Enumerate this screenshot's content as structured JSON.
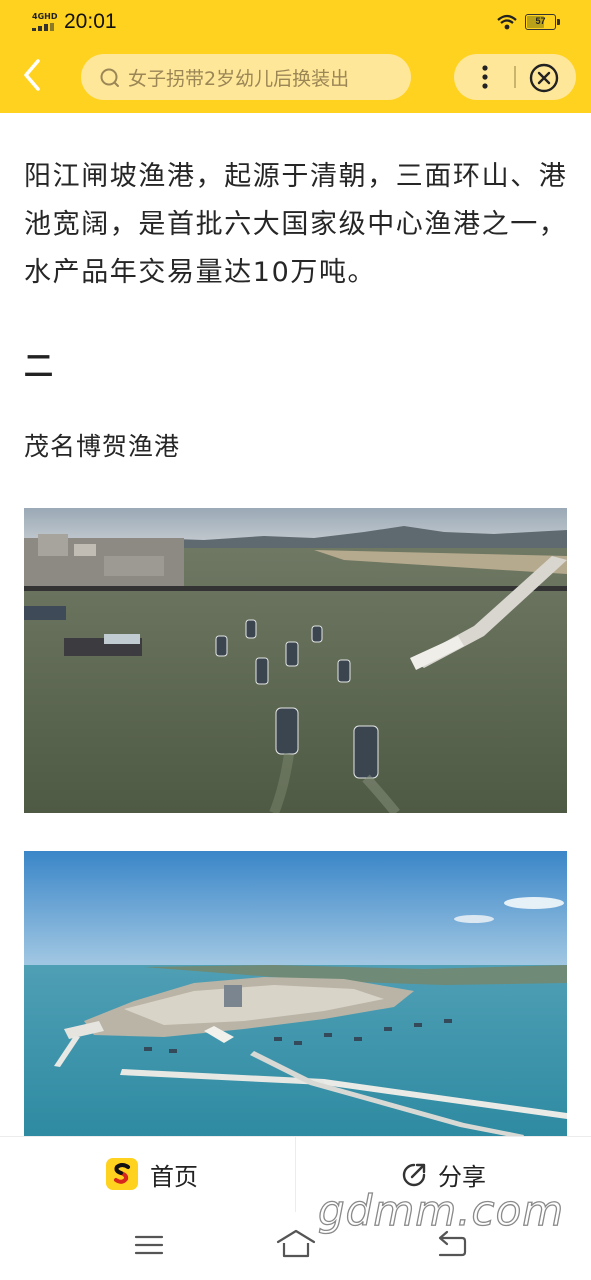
{
  "status_bar": {
    "network": "4GHD",
    "time": "20:01",
    "battery_level": "57"
  },
  "nav": {
    "search_text": "女子拐带2岁幼儿后换装出"
  },
  "article": {
    "paragraph": "阳江闸坡渔港，起源于清朝，三面环山、港池宽阔，是首批六大国家级中心渔港之一，水产品年交易量达10万吨。",
    "section_number": "二",
    "subtitle": "茂名博贺渔港"
  },
  "bottom_bar": {
    "home_label": "首页",
    "share_label": "分享"
  },
  "watermark": "gdmm.com",
  "colors": {
    "header_bg": "#ffd21f",
    "search_bg": "#ffe79a",
    "text": "#262626"
  },
  "icons": [
    "back-icon",
    "search-icon",
    "more-icon",
    "close-icon",
    "app-logo-icon",
    "share-icon",
    "menu-icon",
    "home-icon",
    "back-nav-icon",
    "wifi-icon",
    "battery-icon",
    "signal-icon"
  ]
}
